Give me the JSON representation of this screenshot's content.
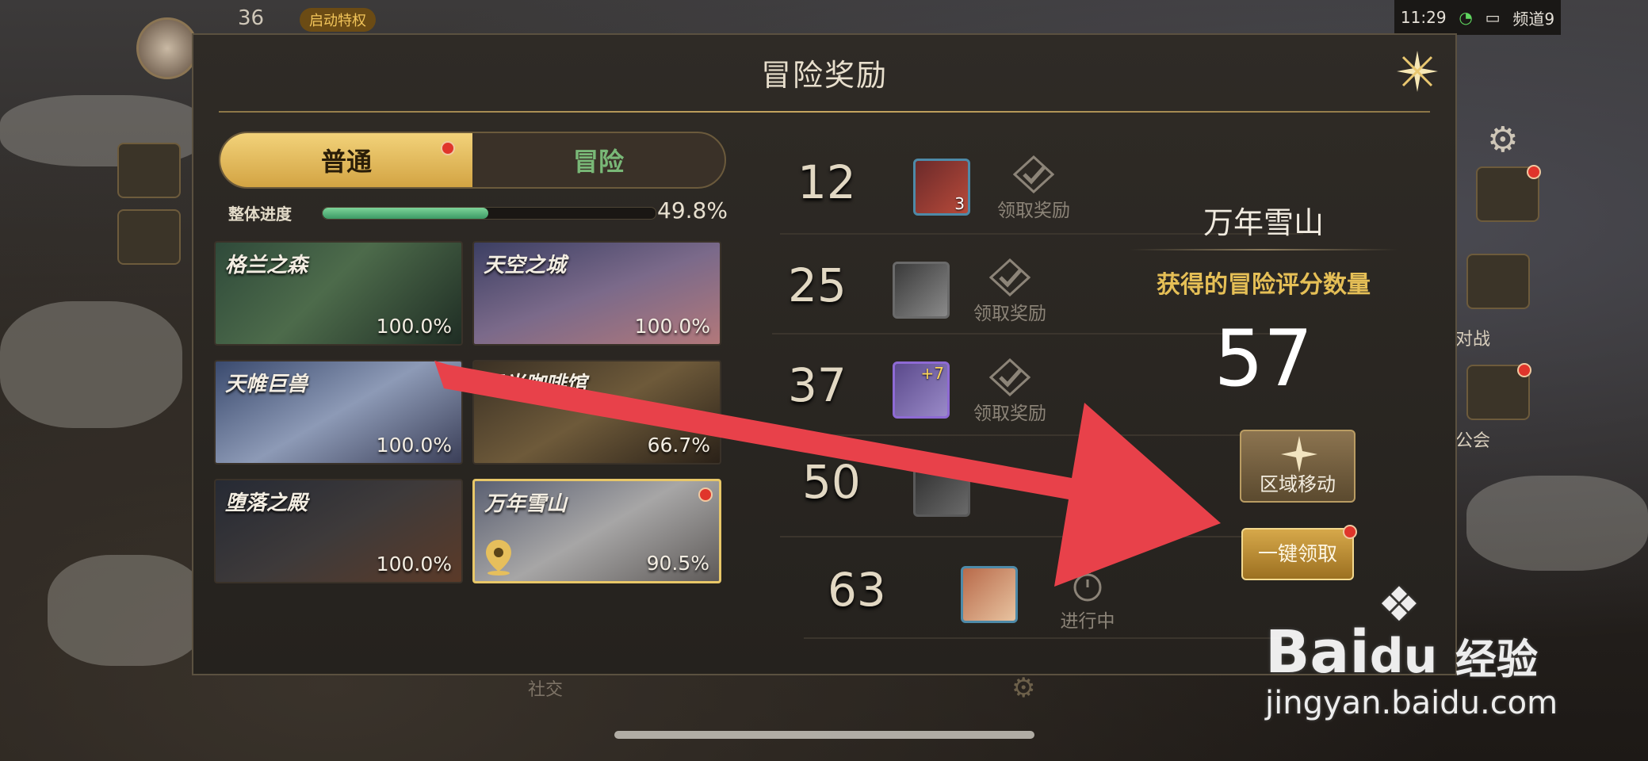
{
  "hud": {
    "level": "36",
    "boost_label": "启动特权",
    "time": "11:29",
    "channel": "频道9",
    "side_labels": {
      "battle": "对战",
      "guild": "公会"
    },
    "bottom_labels": {
      "social": "社交"
    }
  },
  "dialog": {
    "title": "冒险奖励",
    "tabs": [
      {
        "label": "普通",
        "active": true,
        "has_dot": true
      },
      {
        "label": "冒险",
        "active": false,
        "has_dot": false
      }
    ],
    "progress": {
      "label": "整体进度",
      "value_text": "49.8%",
      "fraction": 0.498
    },
    "maps": [
      {
        "name": "格兰之森",
        "pct": "100.0%"
      },
      {
        "name": "天空之城",
        "pct": "100.0%"
      },
      {
        "name": "天帷巨兽",
        "pct": "100.0%"
      },
      {
        "name": "月光咖啡馆",
        "pct": "66.7%"
      },
      {
        "name": "堕落之殿",
        "pct": "100.0%"
      },
      {
        "name": "万年雪山",
        "pct": "90.5%",
        "selected": true
      }
    ],
    "rewards": [
      {
        "threshold": "12",
        "item_count": "3",
        "status": "领取奖励",
        "item": "bag-icon"
      },
      {
        "threshold": "25",
        "item_count": "",
        "status": "领取奖励",
        "item": "box-icon"
      },
      {
        "threshold": "37",
        "item_count": "+7",
        "status": "领取奖励",
        "item": "chest-icon"
      },
      {
        "threshold": "50",
        "item_count": "",
        "status": "",
        "item": "box-icon"
      },
      {
        "threshold": "63",
        "item_count": "",
        "status": "进行中",
        "item": "character-icon"
      }
    ],
    "zone": {
      "name": "万年雪山",
      "score_label": "获得的冒险评分数量",
      "score": "57",
      "move_label": "区域移动",
      "claim_all_label": "一键领取"
    }
  },
  "watermark": {
    "brand_a": "Bai",
    "brand_b": "du",
    "brand_c": "经验",
    "url": "jingyan.baidu.com"
  },
  "colors": {
    "accent_gold": "#e5bf56",
    "tab_green": "#79b877",
    "progress_green": "#3c9a64",
    "arrow_red": "#e8414a"
  }
}
